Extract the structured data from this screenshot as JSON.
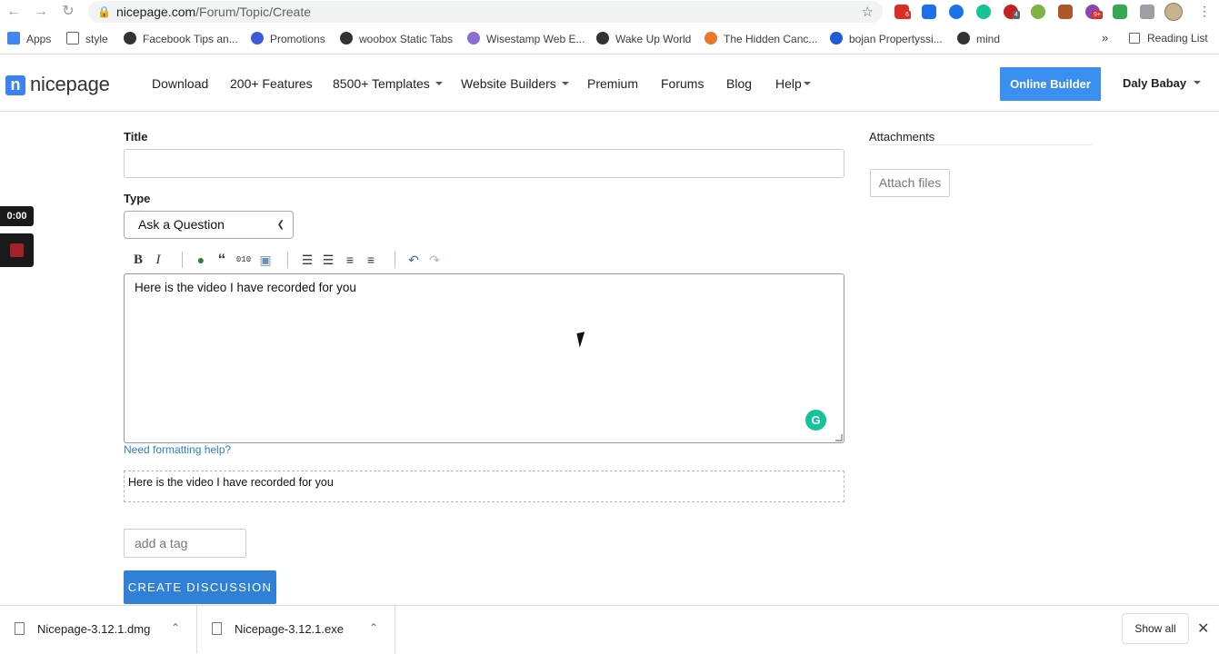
{
  "browser": {
    "url_host": "nicepage.com",
    "url_path": "/Forum/Topic/Create",
    "ext_badges": [
      "6",
      "4",
      "9+"
    ],
    "bookmarks": [
      {
        "label": "Apps",
        "color": "#ea4335"
      },
      {
        "label": "style",
        "color": "#5f6368"
      },
      {
        "label": "Facebook Tips an...",
        "color": "#333333"
      },
      {
        "label": "Promotions",
        "color": "#3b5bdb"
      },
      {
        "label": "woobox Static Tabs",
        "color": "#333333"
      },
      {
        "label": "Wisestamp Web E...",
        "color": "#8a6fd1"
      },
      {
        "label": "Wake Up World",
        "color": "#333333"
      },
      {
        "label": "The Hidden Canc...",
        "color": "#e8762b"
      },
      {
        "label": "bojan Propertyssi...",
        "color": "#1e5cd8"
      },
      {
        "label": "mind",
        "color": "#333333"
      }
    ],
    "more_label": "»",
    "reading_list": "Reading List"
  },
  "site": {
    "logo_letter": "n",
    "logo_text": "nicepage",
    "menu": [
      {
        "label": "Download",
        "dropdown": false
      },
      {
        "label": "200+ Features",
        "dropdown": false
      },
      {
        "label": "8500+ Templates",
        "dropdown": true
      },
      {
        "label": "Website Builders",
        "dropdown": true
      },
      {
        "label": "Premium",
        "dropdown": false
      },
      {
        "label": "Forums",
        "dropdown": false
      },
      {
        "label": "Blog",
        "dropdown": false
      },
      {
        "label": "Help",
        "dropdown": true
      }
    ],
    "online_builder": "Online Builder",
    "user_name": "Daly Babay"
  },
  "form": {
    "title_label": "Title",
    "title_value": "",
    "type_label": "Type",
    "type_value": "Ask a Question",
    "toolbar_icons": [
      "bold-icon",
      "italic-icon",
      "link-icon",
      "quote-icon",
      "code-icon",
      "image-icon",
      "ordered-list-icon",
      "unordered-list-icon",
      "heading-icon",
      "horizontal-rule-icon",
      "undo-icon",
      "redo-icon"
    ],
    "editor_text": "Here is the video I have recorded for you",
    "help_link": "Need formatting help?",
    "preview_text": "Here is the video I have recorded for you",
    "tag_placeholder": "add a tag",
    "submit_label": "CREATE DISCUSSION",
    "attachments_label": "Attachments",
    "attach_button": "Attach files"
  },
  "recorder": {
    "time": "0:00"
  },
  "downloads": {
    "items": [
      "Nicepage-3.12.1.dmg",
      "Nicepage-3.12.1.exe"
    ],
    "show_all": "Show all"
  },
  "colors": {
    "brand_blue": "#3b8ff0",
    "submit_blue": "#2f80d6",
    "link_blue": "#2f7fc0",
    "grammarly": "#15c39a",
    "recorder_stop": "#a3202c"
  }
}
